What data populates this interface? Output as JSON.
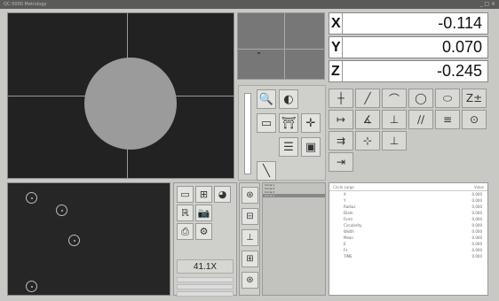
{
  "window": {
    "title": "QC-5000 Metrology",
    "controls": "_ □ ×"
  },
  "dro": {
    "axes": [
      {
        "axis": "X",
        "value": "-0.114"
      },
      {
        "axis": "Y",
        "value": "0.070"
      },
      {
        "axis": "Z",
        "value": "-0.245"
      }
    ]
  },
  "camera": {
    "zoom": "41.1X"
  },
  "icons": {
    "light_tools": [
      "magnifier-icon",
      "contrast-icon",
      "",
      "backlight-icon",
      "ringlight-icon",
      "crosshair-icon",
      "",
      "grid-icon",
      "profile-icon",
      "probe-icon"
    ],
    "light_glyphs": [
      "🔍",
      "◐",
      "",
      "▭",
      "⛩",
      "✛",
      "",
      "☰",
      "▣",
      "╲"
    ],
    "measure_glyphs": [
      "┼",
      "╱",
      "⌒",
      "◯",
      "⬭",
      "Z±",
      "↦",
      "∡",
      "⊥",
      "∕∕",
      "≡",
      "⊙",
      "⇉",
      "⊹",
      "⊥",
      "",
      "",
      "",
      "⇥"
    ],
    "measure_names": [
      "point-icon",
      "line-icon",
      "arc-icon",
      "circle-icon",
      "slot-icon",
      "z-height-icon",
      "distance-icon",
      "angle-icon",
      "perpendicular-icon",
      "parallel-icon",
      "width-icon",
      "concentric-icon",
      "align-icon",
      "origin-icon",
      "datum-icon",
      "",
      "",
      "",
      "export-icon"
    ],
    "tool_glyphs": [
      "▭",
      "⊞",
      "◕",
      "ℝ",
      "📷",
      "",
      "⎙",
      "⚙",
      ""
    ],
    "tool_names": [
      "window-icon",
      "layout-icon",
      "color-icon",
      "text-icon",
      "camera-icon",
      "",
      "print-icon",
      "settings-icon",
      ""
    ],
    "feature_glyphs": [
      "⊛",
      "⊟",
      "⊥",
      "⊞",
      "⊛"
    ]
  },
  "features": {
    "items": [
      "Circle 1",
      "Circle 2",
      "Circle 3",
      "Circle 4"
    ]
  },
  "results": {
    "header_left": "Circle Large",
    "header_right": "Value",
    "rows": [
      {
        "label": "X",
        "value": "0.000"
      },
      {
        "label": "Y",
        "value": "0.000"
      },
      {
        "label": "Radius",
        "value": "0.000"
      },
      {
        "label": "Diam",
        "value": "0.000"
      },
      {
        "label": "Form",
        "value": "0.000"
      },
      {
        "label": "Circularity",
        "value": "0.000"
      },
      {
        "label": "Width",
        "value": "0.000"
      },
      {
        "label": "Mean",
        "value": "0.000"
      },
      {
        "label": "E",
        "value": "0.000"
      },
      {
        "label": "Fs",
        "value": "0.000"
      },
      {
        "label": "TIME",
        "value": "0.000"
      }
    ]
  }
}
